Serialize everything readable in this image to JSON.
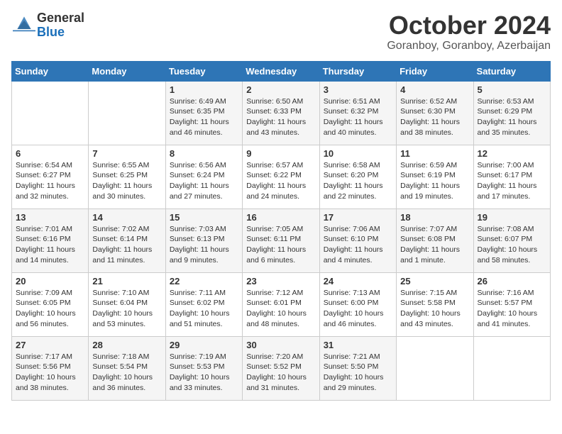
{
  "logo": {
    "general": "General",
    "blue": "Blue"
  },
  "header": {
    "month": "October 2024",
    "location": "Goranboy, Goranboy, Azerbaijan"
  },
  "weekdays": [
    "Sunday",
    "Monday",
    "Tuesday",
    "Wednesday",
    "Thursday",
    "Friday",
    "Saturday"
  ],
  "weeks": [
    [
      {
        "day": "",
        "info": ""
      },
      {
        "day": "",
        "info": ""
      },
      {
        "day": "1",
        "info": "Sunrise: 6:49 AM\nSunset: 6:35 PM\nDaylight: 11 hours and 46 minutes."
      },
      {
        "day": "2",
        "info": "Sunrise: 6:50 AM\nSunset: 6:33 PM\nDaylight: 11 hours and 43 minutes."
      },
      {
        "day": "3",
        "info": "Sunrise: 6:51 AM\nSunset: 6:32 PM\nDaylight: 11 hours and 40 minutes."
      },
      {
        "day": "4",
        "info": "Sunrise: 6:52 AM\nSunset: 6:30 PM\nDaylight: 11 hours and 38 minutes."
      },
      {
        "day": "5",
        "info": "Sunrise: 6:53 AM\nSunset: 6:29 PM\nDaylight: 11 hours and 35 minutes."
      }
    ],
    [
      {
        "day": "6",
        "info": "Sunrise: 6:54 AM\nSunset: 6:27 PM\nDaylight: 11 hours and 32 minutes."
      },
      {
        "day": "7",
        "info": "Sunrise: 6:55 AM\nSunset: 6:25 PM\nDaylight: 11 hours and 30 minutes."
      },
      {
        "day": "8",
        "info": "Sunrise: 6:56 AM\nSunset: 6:24 PM\nDaylight: 11 hours and 27 minutes."
      },
      {
        "day": "9",
        "info": "Sunrise: 6:57 AM\nSunset: 6:22 PM\nDaylight: 11 hours and 24 minutes."
      },
      {
        "day": "10",
        "info": "Sunrise: 6:58 AM\nSunset: 6:20 PM\nDaylight: 11 hours and 22 minutes."
      },
      {
        "day": "11",
        "info": "Sunrise: 6:59 AM\nSunset: 6:19 PM\nDaylight: 11 hours and 19 minutes."
      },
      {
        "day": "12",
        "info": "Sunrise: 7:00 AM\nSunset: 6:17 PM\nDaylight: 11 hours and 17 minutes."
      }
    ],
    [
      {
        "day": "13",
        "info": "Sunrise: 7:01 AM\nSunset: 6:16 PM\nDaylight: 11 hours and 14 minutes."
      },
      {
        "day": "14",
        "info": "Sunrise: 7:02 AM\nSunset: 6:14 PM\nDaylight: 11 hours and 11 minutes."
      },
      {
        "day": "15",
        "info": "Sunrise: 7:03 AM\nSunset: 6:13 PM\nDaylight: 11 hours and 9 minutes."
      },
      {
        "day": "16",
        "info": "Sunrise: 7:05 AM\nSunset: 6:11 PM\nDaylight: 11 hours and 6 minutes."
      },
      {
        "day": "17",
        "info": "Sunrise: 7:06 AM\nSunset: 6:10 PM\nDaylight: 11 hours and 4 minutes."
      },
      {
        "day": "18",
        "info": "Sunrise: 7:07 AM\nSunset: 6:08 PM\nDaylight: 11 hours and 1 minute."
      },
      {
        "day": "19",
        "info": "Sunrise: 7:08 AM\nSunset: 6:07 PM\nDaylight: 10 hours and 58 minutes."
      }
    ],
    [
      {
        "day": "20",
        "info": "Sunrise: 7:09 AM\nSunset: 6:05 PM\nDaylight: 10 hours and 56 minutes."
      },
      {
        "day": "21",
        "info": "Sunrise: 7:10 AM\nSunset: 6:04 PM\nDaylight: 10 hours and 53 minutes."
      },
      {
        "day": "22",
        "info": "Sunrise: 7:11 AM\nSunset: 6:02 PM\nDaylight: 10 hours and 51 minutes."
      },
      {
        "day": "23",
        "info": "Sunrise: 7:12 AM\nSunset: 6:01 PM\nDaylight: 10 hours and 48 minutes."
      },
      {
        "day": "24",
        "info": "Sunrise: 7:13 AM\nSunset: 6:00 PM\nDaylight: 10 hours and 46 minutes."
      },
      {
        "day": "25",
        "info": "Sunrise: 7:15 AM\nSunset: 5:58 PM\nDaylight: 10 hours and 43 minutes."
      },
      {
        "day": "26",
        "info": "Sunrise: 7:16 AM\nSunset: 5:57 PM\nDaylight: 10 hours and 41 minutes."
      }
    ],
    [
      {
        "day": "27",
        "info": "Sunrise: 7:17 AM\nSunset: 5:56 PM\nDaylight: 10 hours and 38 minutes."
      },
      {
        "day": "28",
        "info": "Sunrise: 7:18 AM\nSunset: 5:54 PM\nDaylight: 10 hours and 36 minutes."
      },
      {
        "day": "29",
        "info": "Sunrise: 7:19 AM\nSunset: 5:53 PM\nDaylight: 10 hours and 33 minutes."
      },
      {
        "day": "30",
        "info": "Sunrise: 7:20 AM\nSunset: 5:52 PM\nDaylight: 10 hours and 31 minutes."
      },
      {
        "day": "31",
        "info": "Sunrise: 7:21 AM\nSunset: 5:50 PM\nDaylight: 10 hours and 29 minutes."
      },
      {
        "day": "",
        "info": ""
      },
      {
        "day": "",
        "info": ""
      }
    ]
  ]
}
